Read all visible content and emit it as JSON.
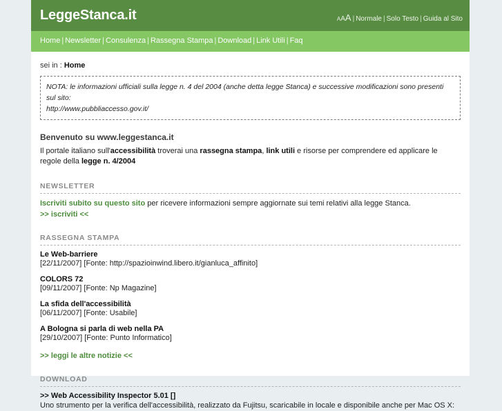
{
  "header": {
    "site_title": "LeggeStanca.it",
    "text_size_small": "A",
    "text_size_medium": "A",
    "text_size_large": "A",
    "separator": "|",
    "view_normale": "Normale",
    "view_solo_testo": "Solo Testo",
    "guida": "Guida al Sito"
  },
  "nav": {
    "separator": "|",
    "items": [
      {
        "label": "Home"
      },
      {
        "label": "Newsletter"
      },
      {
        "label": "Consulenza"
      },
      {
        "label": "Rassegna Stampa"
      },
      {
        "label": "Download"
      },
      {
        "label": "Link Utili"
      },
      {
        "label": "Faq"
      }
    ]
  },
  "breadcrumb": {
    "prefix": "sei in :",
    "current": "Home"
  },
  "nota": {
    "line1": "NOTA: le informazioni ufficiali sulla legge n. 4 del 2004 (anche detta legge Stanca) e successive modificazioni sono presenti sul sito:",
    "line2": "http://www.pubbliaccesso.gov.it/"
  },
  "welcome": {
    "heading": "Benvenuto su www.leggestanca.it",
    "part1": "Il portale italiano sull'",
    "bold1": "accessibilità",
    "part2": " troverai una ",
    "bold2": "rassegna stampa",
    "part3": ", ",
    "bold3": "link utili",
    "part4": " e risorse per comprendere ed applicare le regole della ",
    "bold4": "legge n. 4/2004"
  },
  "newsletter": {
    "title": "NEWSLETTER",
    "link_text": "Iscriviti subito su questo sito",
    "rest_text": " per ricevere informazioni sempre aggiornate sui temi relativi alla legge Stanca.",
    "more_link": ">> iscriviti <<"
  },
  "rassegna_stampa": {
    "title": "RASSEGNA STAMPA",
    "items": [
      {
        "title": "Le Web-barriere",
        "meta": "[22/11/2007] [Fonte: http://spazioinwind.libero.it/gianluca_affinito]"
      },
      {
        "title": "COLORS 72",
        "meta": "[09/11/2007] [Fonte: Np Magazine]"
      },
      {
        "title": "La sfida dell'accessibilità",
        "meta": "[06/11/2007] [Fonte: Usabile]"
      },
      {
        "title": "A Bologna si parla di web nella PA",
        "meta": "[29/10/2007] [Fonte: Punto Informatico]"
      }
    ],
    "more_link": ">> leggi le altre notizie <<"
  },
  "download": {
    "title": "DOWNLOAD",
    "item_title": ">> Web Accessibility Inspector 5.01 []",
    "item_desc": "Uno strumento per la verifica dell'accessibilità, realizzato da Fujitsu, scaricabile in locale e disponibile anche per Mac OS X:"
  },
  "colors": {
    "header_green": "#588c43",
    "nav_green": "#84c763",
    "link_green": "#4d8c3c",
    "page_bg": "#e9eff1",
    "content_bg": "#ffffff"
  }
}
